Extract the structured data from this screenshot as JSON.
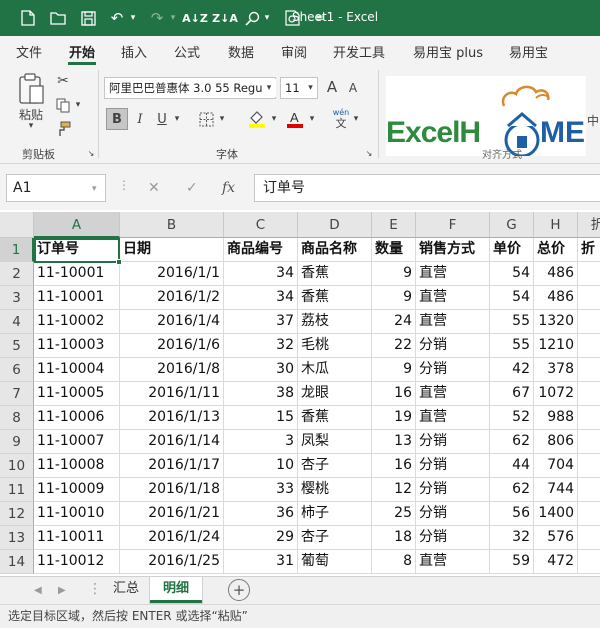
{
  "window": {
    "title": "Sheet1 - Excel"
  },
  "ribbon_tabs": [
    "文件",
    "开始",
    "插入",
    "公式",
    "数据",
    "审阅",
    "开发工具",
    "易用宝 plus",
    "易用宝"
  ],
  "ribbon": {
    "paste_label": "粘贴",
    "clipboard_label": "剪贴板",
    "font_label": "字体",
    "font_name": "阿里巴巴普惠体 3.0 55 Regu",
    "font_size": "11",
    "bold": "B",
    "italic": "I",
    "underline": "U",
    "grow_font": "A",
    "shrink_font": "A",
    "wen_top": "wén",
    "wen_bottom": "文",
    "right_edge_text": "中",
    "logo_text": "ExcelH",
    "logo_text2": "ME",
    "logo_sub": "对齐方式"
  },
  "formula_bar": {
    "name_box": "A1",
    "fx": "fx",
    "value": "订单号"
  },
  "columns": [
    "A",
    "B",
    "C",
    "D",
    "E",
    "F",
    "G",
    "H",
    "折"
  ],
  "rows": [
    1,
    2,
    3,
    4,
    5,
    6,
    7,
    8,
    9,
    10,
    11,
    12,
    13,
    14
  ],
  "table": {
    "header": [
      "订单号",
      "日期",
      "商品编号",
      "商品名称",
      "数量",
      "销售方式",
      "单价",
      "总价",
      "折"
    ],
    "data": [
      [
        "11-10001",
        "2016/1/1",
        "34",
        "香蕉",
        "9",
        "直营",
        "54",
        "486"
      ],
      [
        "11-10001",
        "2016/1/2",
        "34",
        "香蕉",
        "9",
        "直营",
        "54",
        "486"
      ],
      [
        "11-10002",
        "2016/1/4",
        "37",
        "荔枝",
        "24",
        "直营",
        "55",
        "1320"
      ],
      [
        "11-10003",
        "2016/1/6",
        "32",
        "毛桃",
        "22",
        "分销",
        "55",
        "1210"
      ],
      [
        "11-10004",
        "2016/1/8",
        "30",
        "木瓜",
        "9",
        "分销",
        "42",
        "378"
      ],
      [
        "11-10005",
        "2016/1/11",
        "38",
        "龙眼",
        "16",
        "直营",
        "67",
        "1072"
      ],
      [
        "11-10006",
        "2016/1/13",
        "15",
        "香蕉",
        "19",
        "直营",
        "52",
        "988"
      ],
      [
        "11-10007",
        "2016/1/14",
        "3",
        "凤梨",
        "13",
        "分销",
        "62",
        "806"
      ],
      [
        "11-10008",
        "2016/1/17",
        "10",
        "杏子",
        "16",
        "分销",
        "44",
        "704"
      ],
      [
        "11-10009",
        "2016/1/18",
        "33",
        "樱桃",
        "12",
        "分销",
        "62",
        "744"
      ],
      [
        "11-10010",
        "2016/1/21",
        "36",
        "柿子",
        "25",
        "分销",
        "56",
        "1400"
      ],
      [
        "11-10011",
        "2016/1/24",
        "29",
        "杏子",
        "18",
        "分销",
        "32",
        "576"
      ],
      [
        "11-10012",
        "2016/1/25",
        "31",
        "葡萄",
        "8",
        "直营",
        "59",
        "472"
      ]
    ]
  },
  "sheets": [
    "汇总",
    "明细"
  ],
  "active_sheet": "明细",
  "add_sheet": "+",
  "status": {
    "text": "选定目标区域，然后按 ENTER 或选择“粘贴”"
  },
  "colors": {
    "accent": "#217346",
    "title_bar": "#217346",
    "logo_blue": "#1f5fa6",
    "logo_green": "#2e8b3e",
    "logo_orange": "#d98a2b"
  }
}
